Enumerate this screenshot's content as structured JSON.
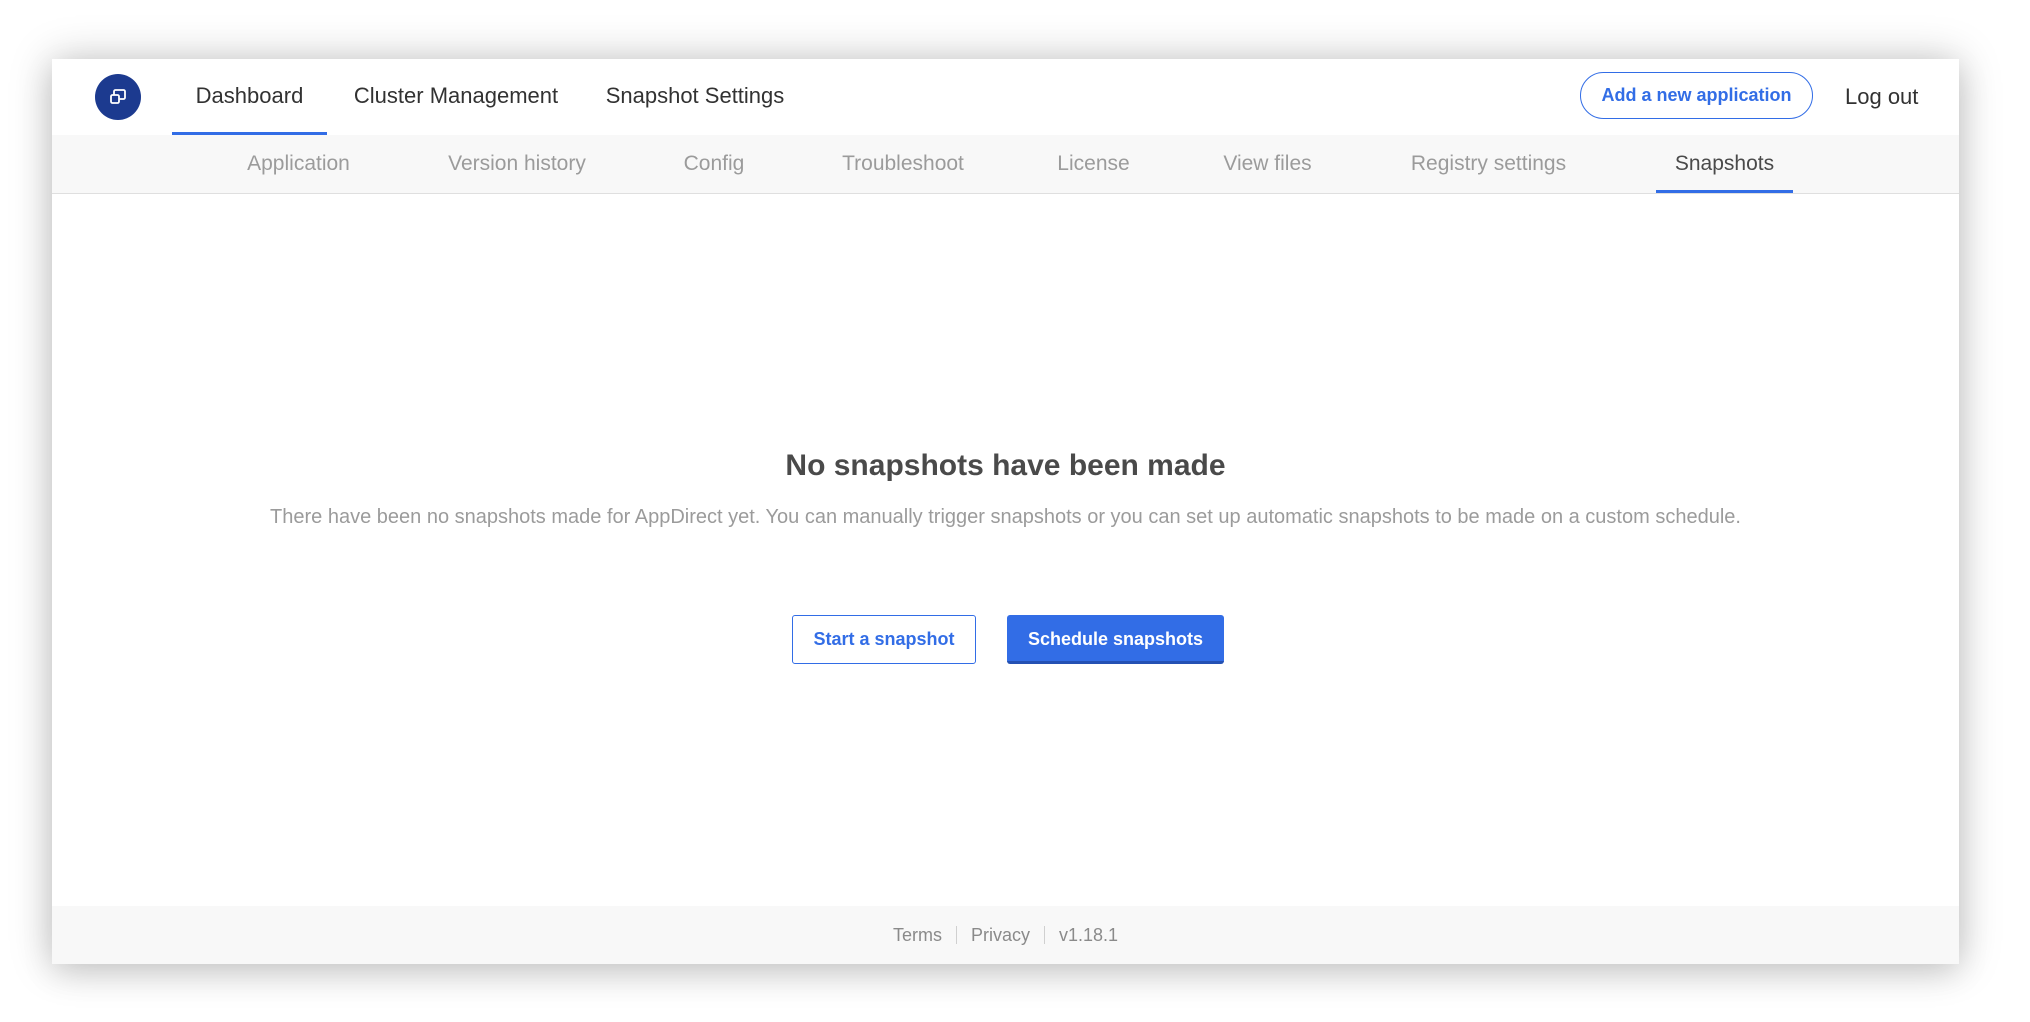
{
  "topnav": {
    "tabs": [
      {
        "label": "Dashboard",
        "active": true
      },
      {
        "label": "Cluster Management",
        "active": false
      },
      {
        "label": "Snapshot Settings",
        "active": false
      }
    ],
    "add_app_label": "Add a new application",
    "logout_label": "Log out"
  },
  "subnav": {
    "tabs": [
      {
        "label": "Application",
        "active": false
      },
      {
        "label": "Version history",
        "active": false
      },
      {
        "label": "Config",
        "active": false
      },
      {
        "label": "Troubleshoot",
        "active": false
      },
      {
        "label": "License",
        "active": false
      },
      {
        "label": "View files",
        "active": false
      },
      {
        "label": "Registry settings",
        "active": false
      },
      {
        "label": "Snapshots",
        "active": true
      }
    ]
  },
  "empty_state": {
    "title": "No snapshots have been made",
    "description": "There have been no snapshots made for AppDirect yet. You can manually trigger snapshots or you can set up automatic snapshots to be made on a custom schedule.",
    "start_label": "Start a snapshot",
    "schedule_label": "Schedule snapshots"
  },
  "footer": {
    "terms": "Terms",
    "privacy": "Privacy",
    "version": "v1.18.1"
  },
  "colors": {
    "accent": "#326de6",
    "logo_bg": "#1c3a8f",
    "text_dark": "#323232",
    "text_muted": "#9b9b9b"
  },
  "icons": {
    "logo": "app-logo-icon"
  }
}
